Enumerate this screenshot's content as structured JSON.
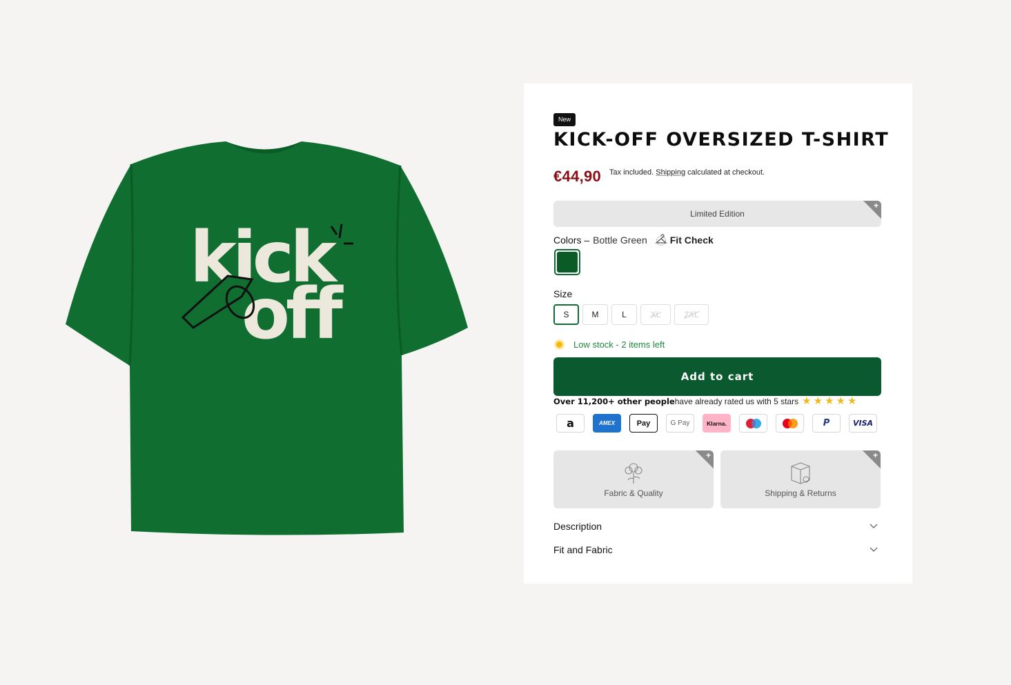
{
  "product": {
    "badge": "New",
    "title": "KICK-OFF OVERSIZED T-SHIRT",
    "price": "€44,90",
    "tax_prefix": "Tax included. ",
    "tax_link": "Shipping",
    "tax_suffix": " calculated at checkout.",
    "graphic_text": [
      "kick",
      "off"
    ],
    "shirt_color": "#0f6e30"
  },
  "limited_edition": {
    "label": "Limited Edition",
    "plus": "+"
  },
  "colors": {
    "label": "Colors –",
    "value": "Bottle Green",
    "fit_check": "Fit Check",
    "fit_check_icon": "hanger-icon",
    "swatch_color": "#0a5b25"
  },
  "size": {
    "label": "Size",
    "options": [
      {
        "label": "S",
        "state": "selected"
      },
      {
        "label": "M",
        "state": "available"
      },
      {
        "label": "L",
        "state": "available"
      },
      {
        "label": "XL",
        "state": "sold-out"
      },
      {
        "label": "2XL",
        "state": "sold-out"
      }
    ]
  },
  "stock": {
    "text": "Low stock - 2 items left"
  },
  "cart": {
    "label": "Add to cart"
  },
  "rating": {
    "bold": "Over 11,200+ other people",
    "text": " have already rated us with 5 stars",
    "stars": 5
  },
  "payments": [
    "a",
    "AMEX",
    "Pay",
    "G Pay",
    "Klarna.",
    "maestro",
    "mastercard",
    "P",
    "VISA"
  ],
  "info_boxes": [
    {
      "label": "Fabric & Quality",
      "icon": "cotton-flower-icon"
    },
    {
      "label": "Shipping & Returns",
      "icon": "package-icon"
    }
  ],
  "accordions": [
    {
      "label": "Description"
    },
    {
      "label": "Fit and Fabric"
    }
  ]
}
